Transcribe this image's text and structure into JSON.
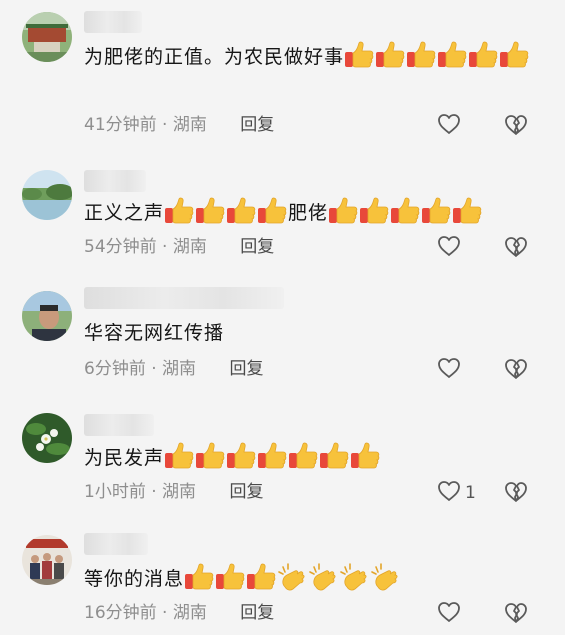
{
  "comments": [
    {
      "avatar": "green-pavilion-avatar",
      "segments": [
        {
          "t": "text",
          "v": "为肥佬的正值。为农民做好事"
        },
        {
          "t": "emoji",
          "v": "thumbs-up"
        },
        {
          "t": "emoji",
          "v": "thumbs-up"
        },
        {
          "t": "emoji",
          "v": "thumbs-up"
        },
        {
          "t": "emoji",
          "v": "thumbs-up"
        },
        {
          "t": "emoji",
          "v": "thumbs-up"
        },
        {
          "t": "emoji",
          "v": "thumbs-up"
        }
      ],
      "time": "41分钟前",
      "location": "湖南",
      "reply": "回复",
      "likes": ""
    },
    {
      "avatar": "lake-landscape-avatar",
      "segments": [
        {
          "t": "text",
          "v": "正义之声"
        },
        {
          "t": "emoji",
          "v": "thumbs-up"
        },
        {
          "t": "emoji",
          "v": "thumbs-up"
        },
        {
          "t": "emoji",
          "v": "thumbs-up"
        },
        {
          "t": "emoji",
          "v": "thumbs-up"
        },
        {
          "t": "text",
          "v": "肥佬"
        },
        {
          "t": "emoji",
          "v": "thumbs-up"
        },
        {
          "t": "emoji",
          "v": "thumbs-up"
        },
        {
          "t": "emoji",
          "v": "thumbs-up"
        },
        {
          "t": "emoji",
          "v": "thumbs-up"
        },
        {
          "t": "emoji",
          "v": "thumbs-up"
        }
      ],
      "time": "54分钟前",
      "location": "湖南",
      "reply": "回复",
      "likes": ""
    },
    {
      "avatar": "man-portrait-avatar",
      "segments": [
        {
          "t": "text",
          "v": "华容无网红传播"
        }
      ],
      "time": "6分钟前",
      "location": "湖南",
      "reply": "回复",
      "likes": ""
    },
    {
      "avatar": "flower-avatar",
      "segments": [
        {
          "t": "text",
          "v": "为民发声"
        },
        {
          "t": "emoji",
          "v": "thumbs-up"
        },
        {
          "t": "emoji",
          "v": "thumbs-up"
        },
        {
          "t": "emoji",
          "v": "thumbs-up"
        },
        {
          "t": "emoji",
          "v": "thumbs-up"
        },
        {
          "t": "emoji",
          "v": "thumbs-up"
        },
        {
          "t": "emoji",
          "v": "thumbs-up"
        },
        {
          "t": "emoji",
          "v": "thumbs-up"
        }
      ],
      "time": "1小时前",
      "location": "湖南",
      "reply": "回复",
      "likes": "1"
    },
    {
      "avatar": "group-photo-avatar",
      "segments": [
        {
          "t": "text",
          "v": "等你的消息"
        },
        {
          "t": "emoji",
          "v": "thumbs-up"
        },
        {
          "t": "emoji",
          "v": "thumbs-up"
        },
        {
          "t": "emoji",
          "v": "thumbs-up"
        },
        {
          "t": "emoji",
          "v": "clapping-hands"
        },
        {
          "t": "emoji",
          "v": "clapping-hands"
        },
        {
          "t": "emoji",
          "v": "clapping-hands"
        },
        {
          "t": "emoji",
          "v": "clapping-hands"
        }
      ],
      "time": "16分钟前",
      "location": "湖南",
      "reply": "回复",
      "likes": ""
    }
  ],
  "meta_separator": "·",
  "colors": {
    "background": "#f4f4f4",
    "text": "#161616",
    "meta": "#8e8e8e",
    "reply": "#4a4a4a",
    "icon": "#5a5a5a"
  }
}
